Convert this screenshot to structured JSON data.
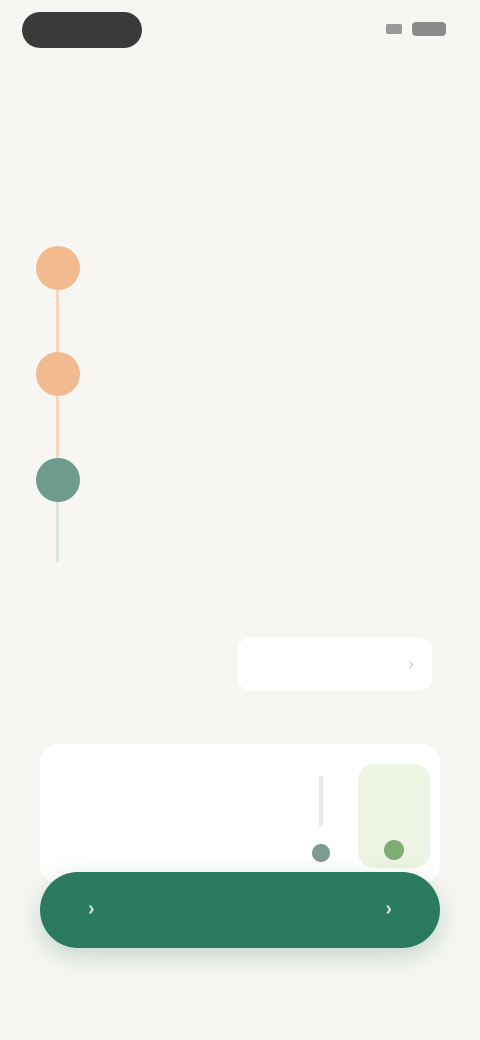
{
  "status_bar": {
    "time": "",
    "signal_icon": "signal-icon",
    "battery_icon": "battery-icon"
  },
  "header": {
    "title": "",
    "subtitle": ""
  },
  "timeline": [
    {
      "label": "",
      "description": "",
      "color": "#f2ba8f"
    },
    {
      "label": "",
      "description": "",
      "color": "#f2ba8f"
    },
    {
      "label": "",
      "description": "",
      "color": "#6f9a8e"
    }
  ],
  "link_row": {
    "label": "",
    "value": "",
    "icon": "chevron-right-icon"
  },
  "plan_card": {
    "title": "",
    "subtitle": "",
    "option_a_icon": "check-icon",
    "option_b_icon": "check-icon"
  },
  "cta": {
    "label": "",
    "left_icon": "sparkle-icon",
    "right_icon": "arrow-right-icon"
  },
  "footer": {
    "note": ""
  },
  "colors": {
    "accent": "#2c7962",
    "orange": "#f2ba8f",
    "muted_green": "#6f9a8e",
    "background": "#f7f6f2"
  }
}
